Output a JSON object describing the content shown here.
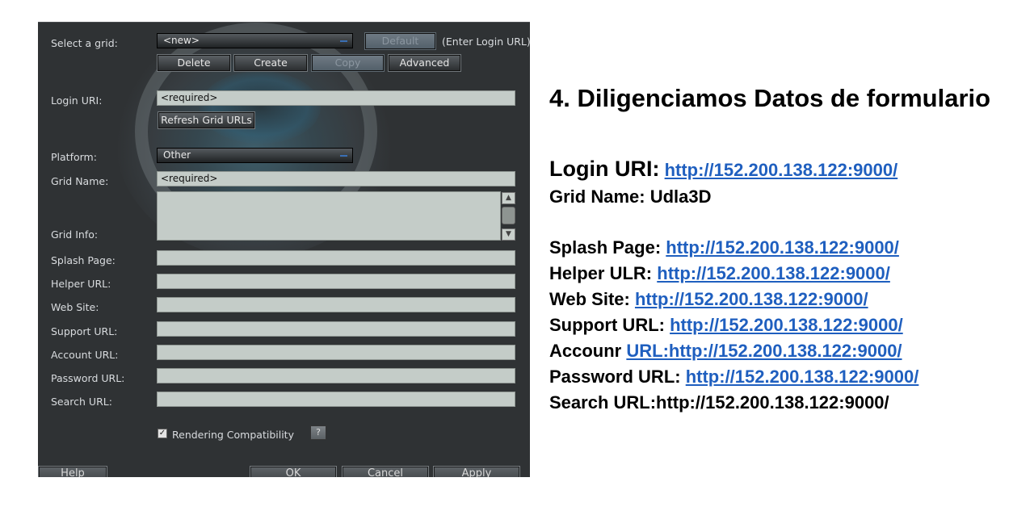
{
  "dialog": {
    "grid_label": "Select a grid:",
    "grid_value": "<new>",
    "default_button": "Default",
    "enter_login_note": "(Enter Login URL)",
    "delete_button": "Delete",
    "create_button": "Create",
    "copy_button": "Copy",
    "advanced_button": "Advanced",
    "login_uri_label": "Login URI:",
    "login_uri_value": "<required>",
    "refresh_button": "Refresh Grid URLs",
    "platform_label": "Platform:",
    "platform_value": "Other",
    "grid_name_label": "Grid Name:",
    "grid_name_value": "<required>",
    "grid_info_label": "Grid Info:",
    "splash_label": "Splash Page:",
    "helper_label": "Helper URL:",
    "website_label": "Web Site:",
    "support_label": "Support URL:",
    "account_label": "Account URL:",
    "password_label": "Password URL:",
    "search_label": "Search URL:",
    "rendering_compat_label": "Rendering Compatibility",
    "rendering_compat_checked": true,
    "question_button": "?",
    "help_button": "Help",
    "ok_button": "OK",
    "cancel_button": "Cancel",
    "apply_button": "Apply"
  },
  "info": {
    "heading": "4. Diligenciamos Datos de formulario",
    "login_uri_key": "Login URI:",
    "login_uri_link": "http://152.200.138.122:9000/",
    "grid_name_line": "Grid Name: Udla3D",
    "splash_key": "Splash Page:",
    "splash_link": "http://152.200.138.122:9000/",
    "helper_key": "Helper ULR:",
    "helper_link": "http://152.200.138.122:9000/",
    "website_key": "Web Site:",
    "website_link": "http://152.200.138.122:9000/",
    "support_key": "Support URL:",
    "support_link": "http://152.200.138.122:9000/",
    "account_key": "Accounr",
    "account_link": "URL:http://152.200.138.122:9000/",
    "password_key": "Password URL:",
    "password_link": "http://152.200.138.122:9000/",
    "search_line": "Search URL:http://152.200.138.122:9000/"
  },
  "colors": {
    "dialog_bg": "#2f3234",
    "field_bg": "#c4ccc8",
    "link": "#1f5fbf"
  }
}
